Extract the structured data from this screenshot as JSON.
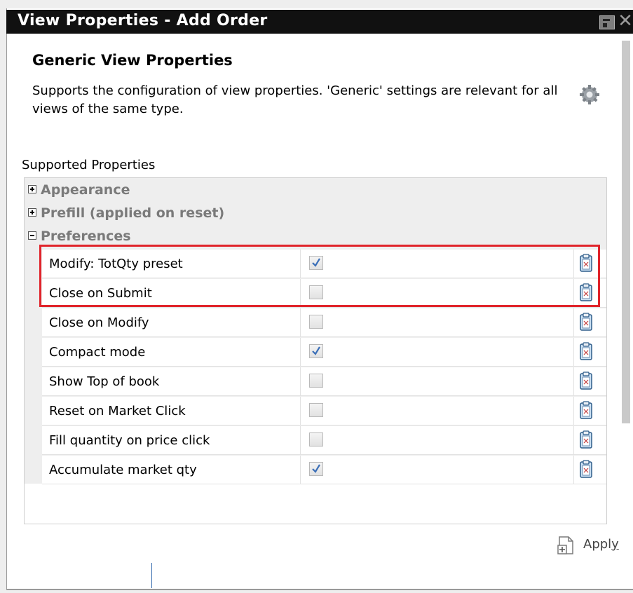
{
  "window": {
    "title": "View Properties - Add Order"
  },
  "header": {
    "title": "Generic View Properties",
    "description": "Supports the configuration of view properties. 'Generic' settings are relevant for all views of the same type."
  },
  "supported_properties_label": "Supported Properties",
  "groups": [
    {
      "label": "Appearance",
      "expanded": false
    },
    {
      "label": "Prefill (applied on reset)",
      "expanded": false
    },
    {
      "label": "Preferences",
      "expanded": true
    }
  ],
  "preferences": [
    {
      "label": "Modify: TotQty preset",
      "checked": true
    },
    {
      "label": "Close on Submit",
      "checked": false
    },
    {
      "label": "Close on Modify",
      "checked": false
    },
    {
      "label": "Compact mode",
      "checked": true
    },
    {
      "label": "Show Top of book",
      "checked": false
    },
    {
      "label": "Reset on Market Click",
      "checked": false
    },
    {
      "label": "Fill quantity on price click",
      "checked": false
    },
    {
      "label": "Accumulate market qty",
      "checked": true
    }
  ],
  "footer": {
    "apply_label_main": "Appl",
    "apply_label_mnemonic": "y"
  },
  "colors": {
    "highlight": "#e0242b",
    "checkmark": "#3b6fb8"
  }
}
